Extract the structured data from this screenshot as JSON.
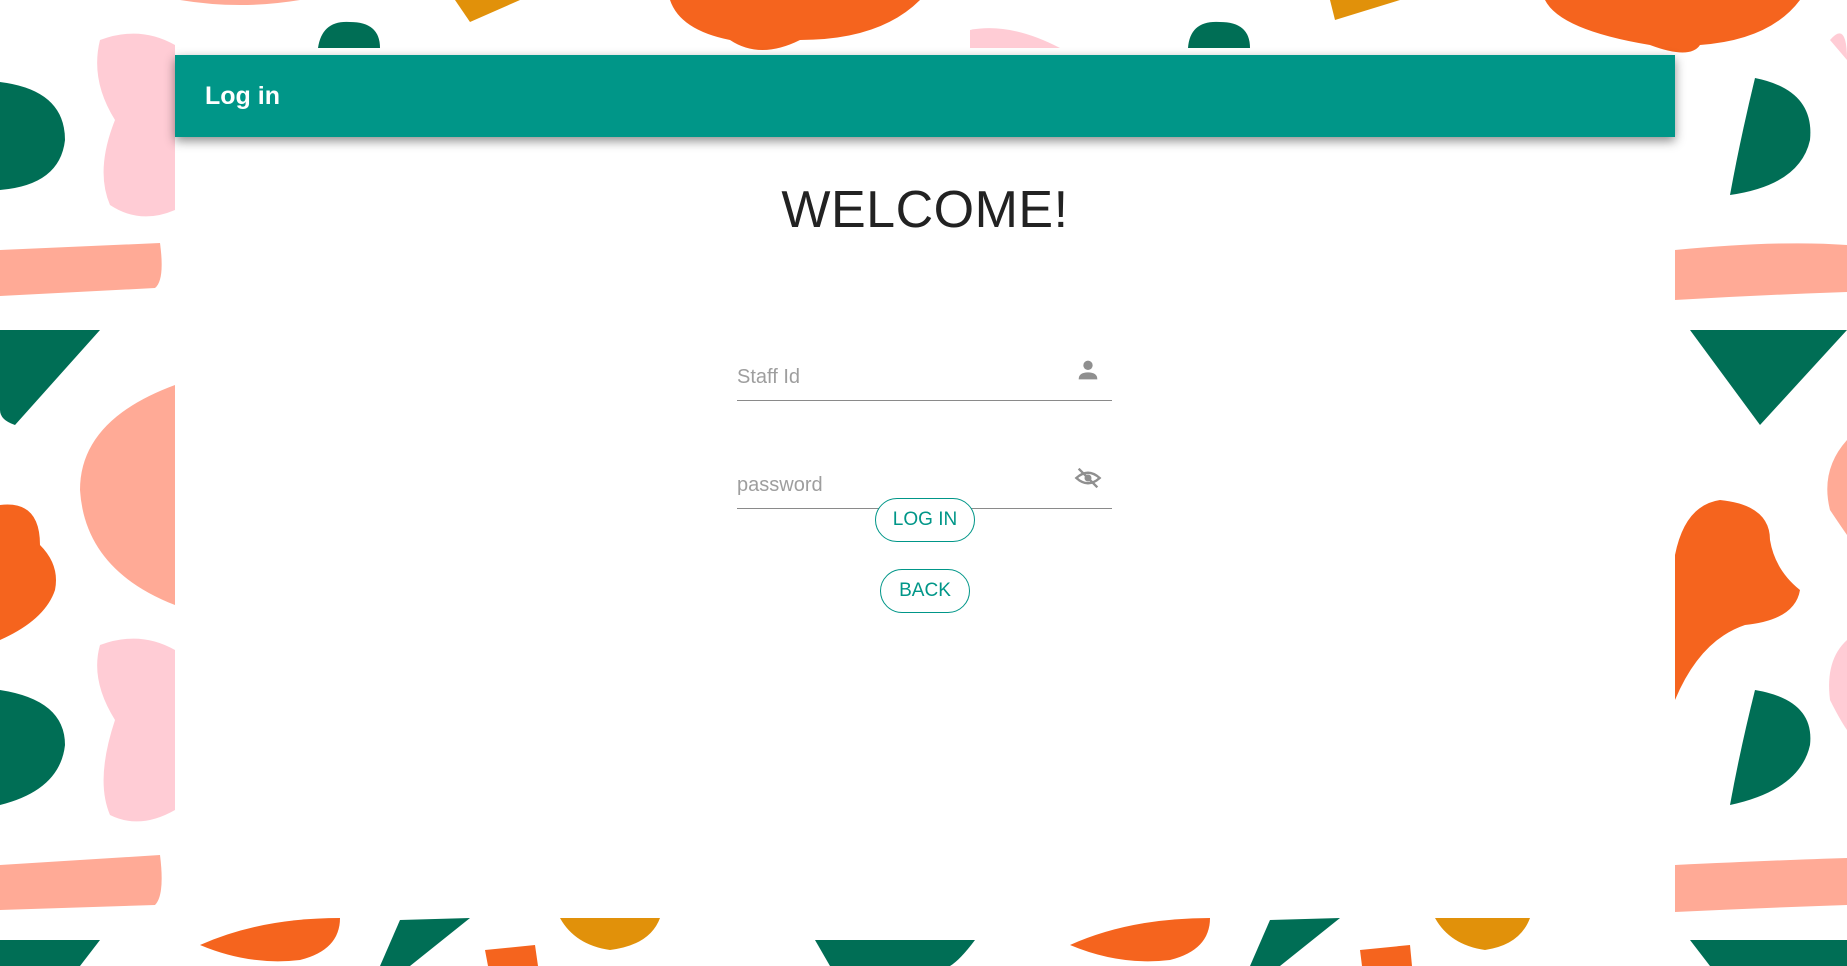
{
  "appbar": {
    "title": "Log in"
  },
  "main": {
    "heading": "WELCOME!",
    "staff_id": {
      "placeholder": "Staff Id",
      "value": "",
      "icon": "person-icon"
    },
    "password": {
      "placeholder": "password",
      "value": "",
      "icon": "eye-off-icon"
    },
    "login_button": "LOG IN",
    "back_button": "BACK"
  },
  "colors": {
    "primary": "#009688",
    "dark_green": "#006E55",
    "orange": "#F5641E",
    "pink": "#FFCCD5",
    "salmon": "#FFAA96",
    "mustard": "#E1910A"
  }
}
